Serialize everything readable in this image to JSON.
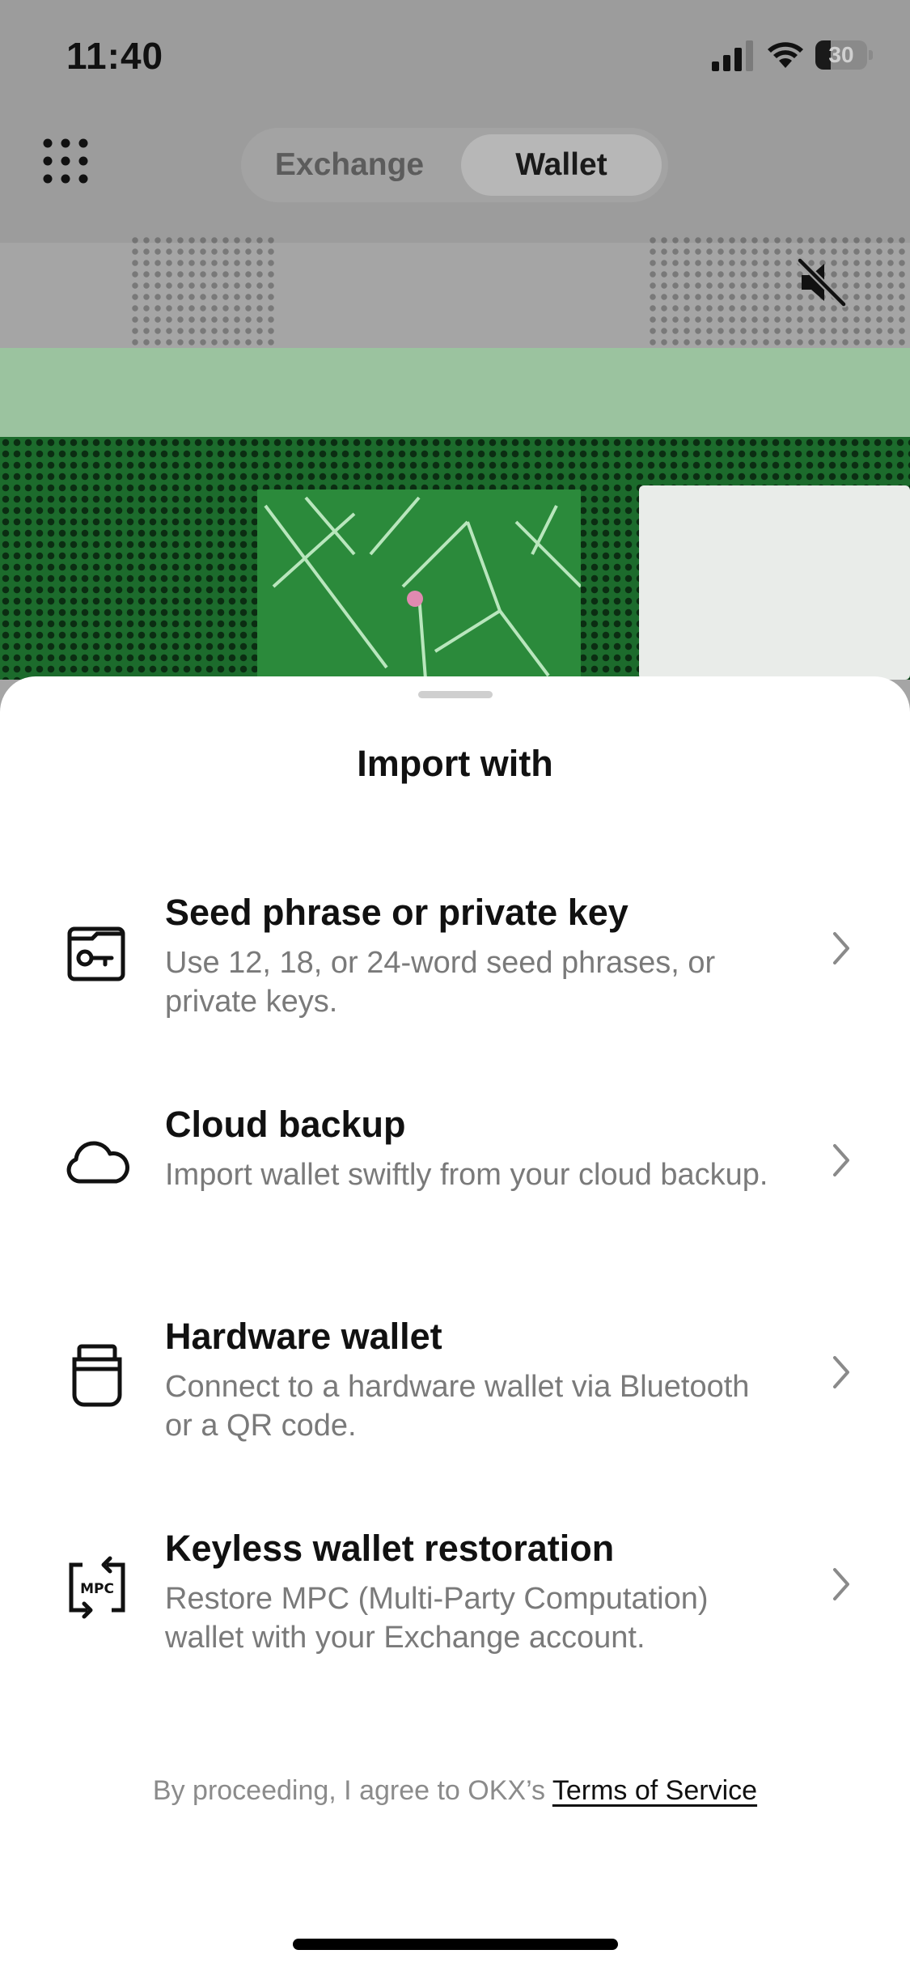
{
  "status_bar": {
    "time": "11:40",
    "battery": "30",
    "battery_fraction": 0.3
  },
  "nav": {
    "tabs": [
      {
        "label": "Exchange",
        "selected": false
      },
      {
        "label": "Wallet",
        "selected": true
      }
    ]
  },
  "icons": {
    "menu": "grid-menu-icon",
    "mute": "speaker-muted-icon"
  },
  "sheet": {
    "title": "Import with",
    "options": [
      {
        "title": "Seed phrase or private key",
        "description": "Use 12, 18, or 24-word seed phrases, or private keys.",
        "icon": "key-card-icon"
      },
      {
        "title": "Cloud backup",
        "description": "Import wallet swiftly from your cloud backup.",
        "icon": "cloud-icon"
      },
      {
        "title": "Hardware wallet",
        "description": "Connect to a hardware wallet via Bluetooth or a QR code.",
        "icon": "hardware-wallet-icon"
      },
      {
        "title": "Keyless wallet restoration",
        "description": "Restore MPC (Multi-Party Computation) wallet with your Exchange account.",
        "icon": "mpc-icon",
        "icon_text": "MPC"
      }
    ],
    "terms_prefix": "By proceeding, I agree to OKX’s",
    "terms_link": "Terms of Service"
  }
}
